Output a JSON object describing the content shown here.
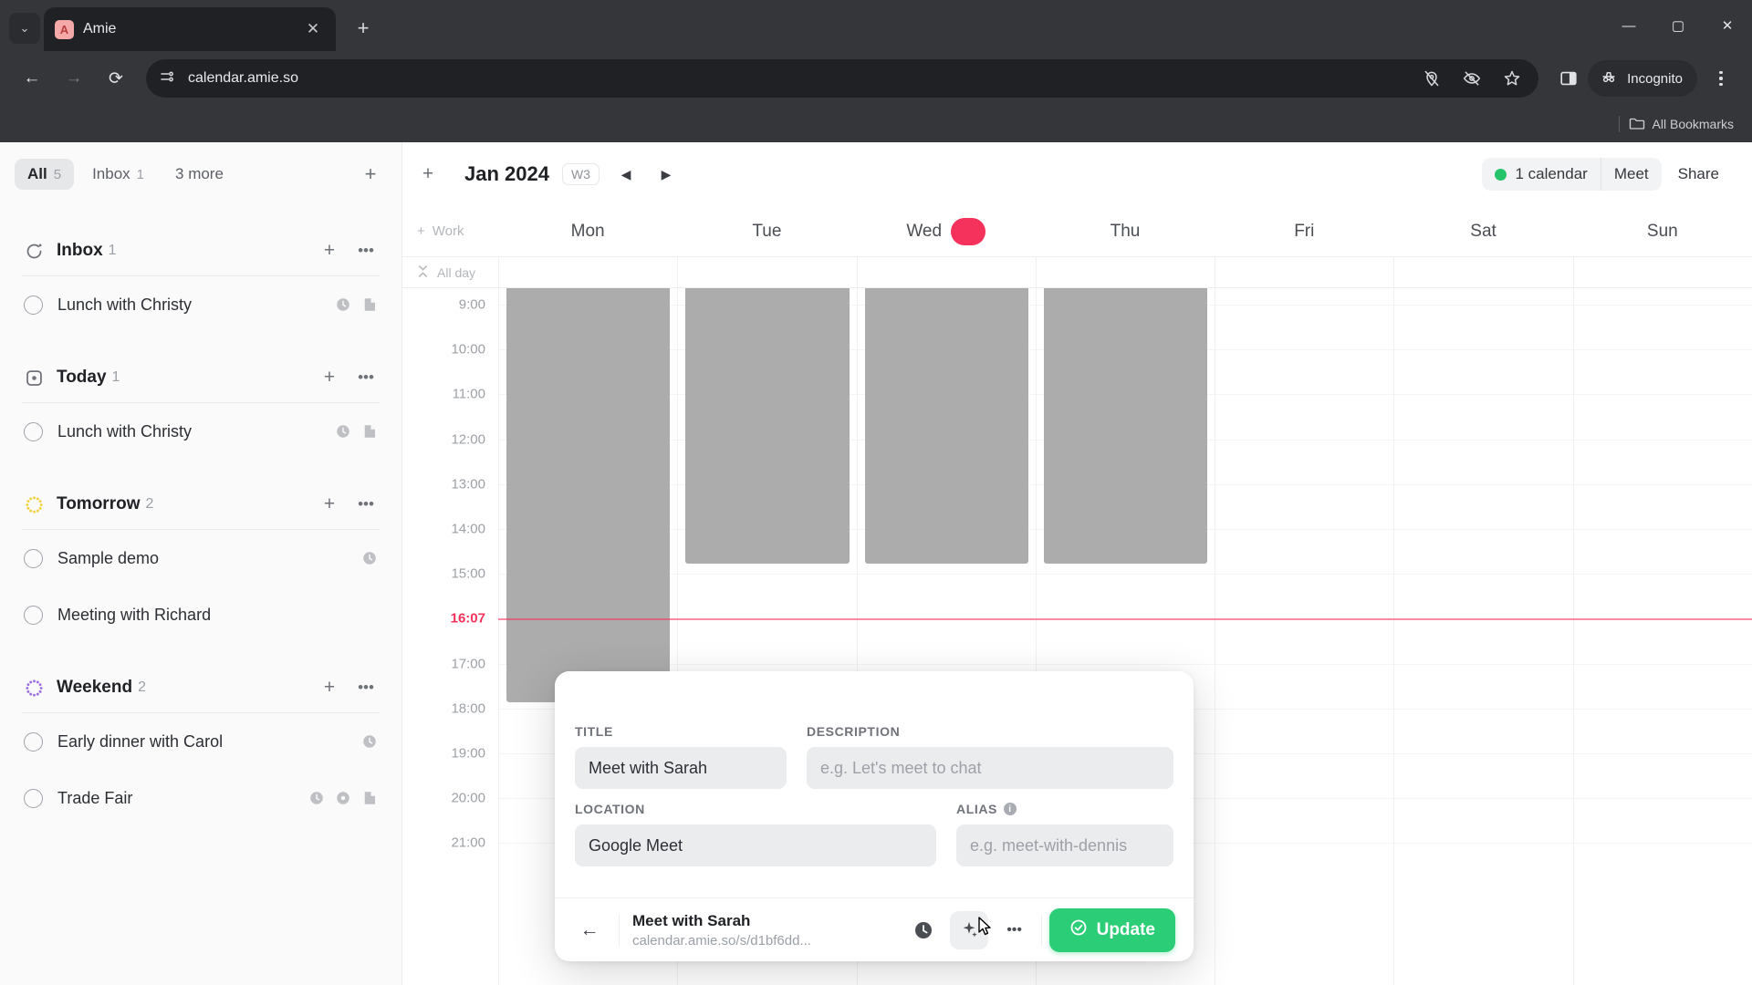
{
  "browser": {
    "tab": {
      "title": "Amie",
      "favicon_letter": "A",
      "close_icon": "close-icon"
    },
    "new_tab_label": "+",
    "chevron_label": "⌄",
    "window": {
      "minimize": "—",
      "maximize": "▢",
      "close": "✕"
    },
    "nav": {
      "back": "←",
      "forward": "→",
      "reload": "⟳"
    },
    "omnibox": {
      "url": "calendar.amie.so",
      "site_info_icon": "page-info-icon"
    },
    "omni_icons": [
      "location-off-icon",
      "eye-off-icon",
      "bookmark-star-icon"
    ],
    "side_panel_icon": "side-panel-icon",
    "incognito_label": "Incognito",
    "menu_icon": "three-dot-menu-icon",
    "bookmarks": {
      "all_label": "All Bookmarks",
      "folder_icon": "folder-icon"
    }
  },
  "sidebar": {
    "tabs": [
      {
        "label": "All",
        "count": "5",
        "active": true
      },
      {
        "label": "Inbox",
        "count": "1",
        "active": false
      },
      {
        "label": "3 more",
        "count": "",
        "active": false
      }
    ],
    "add_label": "+",
    "groups": [
      {
        "title": "Inbox",
        "count": "1",
        "icon": "inbox-refresh-icon",
        "icon_color": "#6f7278",
        "add_label": "+",
        "more_label": "•••",
        "tasks": [
          {
            "label": "Lunch with Christy",
            "icons": [
              "clock-icon",
              "note-icon"
            ]
          }
        ]
      },
      {
        "title": "Today",
        "count": "1",
        "icon": "today-target-icon",
        "icon_color": "#6f7278",
        "add_label": "+",
        "more_label": "•••",
        "tasks": [
          {
            "label": "Lunch with Christy",
            "icons": [
              "clock-icon",
              "note-icon"
            ]
          }
        ]
      },
      {
        "title": "Tomorrow",
        "count": "2",
        "icon": "dotted-circle-icon",
        "icon_color": "#f2d23c",
        "add_label": "+",
        "more_label": "•••",
        "tasks": [
          {
            "label": "Sample demo",
            "icons": [
              "clock-icon"
            ]
          },
          {
            "label": "Meeting with Richard",
            "icons": []
          }
        ]
      },
      {
        "title": "Weekend",
        "count": "2",
        "icon": "dotted-circle-icon",
        "icon_color": "#9b6fe0",
        "add_label": "+",
        "more_label": "•••",
        "tasks": [
          {
            "label": "Early dinner with Carol",
            "icons": [
              "clock-icon"
            ]
          },
          {
            "label": "Trade Fair",
            "icons": [
              "clock-icon",
              "circle-icon",
              "note-icon"
            ]
          }
        ]
      }
    ]
  },
  "calendar": {
    "add_label": "+",
    "month": "Jan 2024",
    "week": "W3",
    "prev_label": "◀",
    "next_label": "▶",
    "calendar_count_label": "1 calendar",
    "meet_label": "Meet",
    "share_label": "Share",
    "accent_green": "#25c46a",
    "today_color": "#f5325b",
    "work_label": "Work",
    "work_add": "+",
    "allday_label": "All day",
    "allday_icon": "collapse-icon",
    "days": [
      {
        "label": "Mon",
        "today": false
      },
      {
        "label": "Tue",
        "today": false
      },
      {
        "label": "Wed",
        "today": true
      },
      {
        "label": "Thu",
        "today": false
      },
      {
        "label": "Fri",
        "today": false
      },
      {
        "label": "Sat",
        "today": false
      },
      {
        "label": "Sun",
        "today": false
      }
    ],
    "hours": [
      "9:00",
      "10:00",
      "11:00",
      "12:00",
      "13:00",
      "14:00",
      "15:00",
      "16:07",
      "17:00",
      "18:00",
      "19:00",
      "20:00",
      "21:00"
    ],
    "current_time": "16:07"
  },
  "modal": {
    "fields": {
      "title_label": "TITLE",
      "title_value": "Meet with Sarah",
      "description_label": "DESCRIPTION",
      "description_placeholder": "e.g. Let's meet to chat",
      "location_label": "LOCATION",
      "location_value": "Google Meet",
      "alias_label": "ALIAS",
      "alias_info_icon": "info-icon",
      "alias_placeholder": "e.g. meet-with-dennis"
    },
    "footer": {
      "back_icon": "back-arrow-icon",
      "title": "Meet with Sarah",
      "url": "calendar.amie.so/s/d1bf6dd...",
      "clock_icon": "clock-icon",
      "sparkle_icon": "sparkle-icon",
      "more_icon": "•••",
      "update_label": "Update",
      "update_check_icon": "check-shield-icon"
    }
  }
}
